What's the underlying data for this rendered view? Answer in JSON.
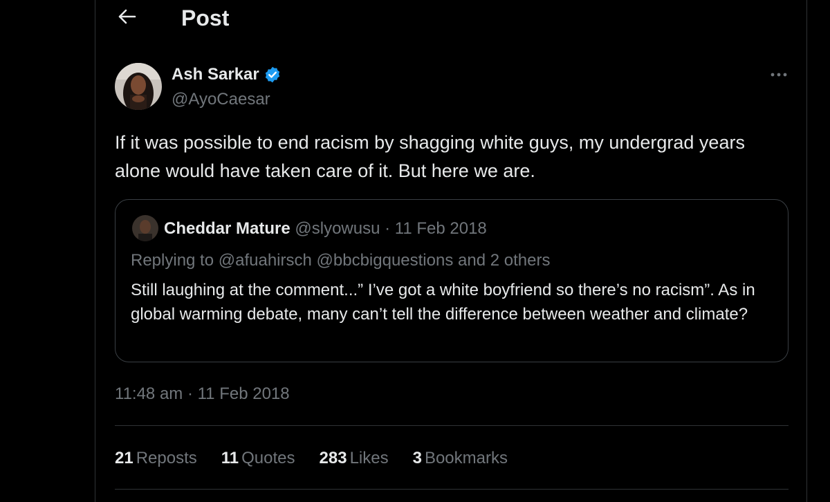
{
  "header": {
    "title": "Post",
    "back_icon": "arrow-left-icon"
  },
  "post": {
    "author_name": "Ash Sarkar",
    "verified_icon": "verified-badge-icon",
    "author_handle": "@AyoCaesar",
    "more_icon": "more-horizontal-icon",
    "text": "If it was possible to end racism by shagging white guys, my undergrad years alone would have taken care of it. But here we are.",
    "timestamp": "11:48 am · 11 Feb 2018"
  },
  "quote": {
    "author_name": "Cheddar Mature",
    "meta": "@slyowusu · 11 Feb 2018",
    "replying_prefix": "Replying to",
    "replying_to": "@afuahirsch @bbcbigquestions",
    "replying_suffix": "and 2 others",
    "text": "Still laughing at the comment...” I’ve got a white boyfriend so there’s no racism”.  As in global warming debate, many can’t tell the difference between weather and climate?"
  },
  "stats": [
    {
      "count": "21",
      "label": "Reposts"
    },
    {
      "count": "11",
      "label": "Quotes"
    },
    {
      "count": "283",
      "label": "Likes"
    },
    {
      "count": "3",
      "label": "Bookmarks"
    }
  ],
  "colors": {
    "background": "#000000",
    "text_primary": "#e7e9ea",
    "text_secondary": "#71767b",
    "border": "#2f3336",
    "verified": "#1d9bf0"
  }
}
